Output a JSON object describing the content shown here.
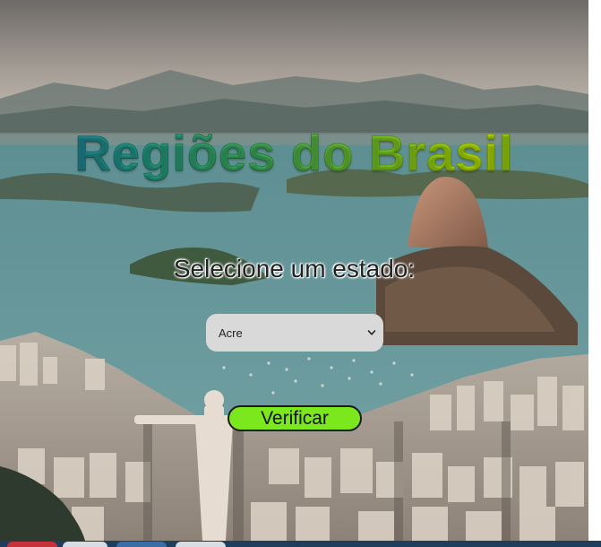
{
  "page": {
    "title": "Regiões do Brasil",
    "prompt": "Selecione um estado:"
  },
  "state_select": {
    "selected": "Acre"
  },
  "actions": {
    "verify_label": "Verificar"
  },
  "colors": {
    "button_bg": "#7be81e",
    "select_bg": "#d9d9d9",
    "title_gradient_start": "#2a6fa8",
    "title_gradient_end": "#b8e000"
  },
  "background": {
    "icon": "rio-de-janeiro-landscape-image"
  }
}
